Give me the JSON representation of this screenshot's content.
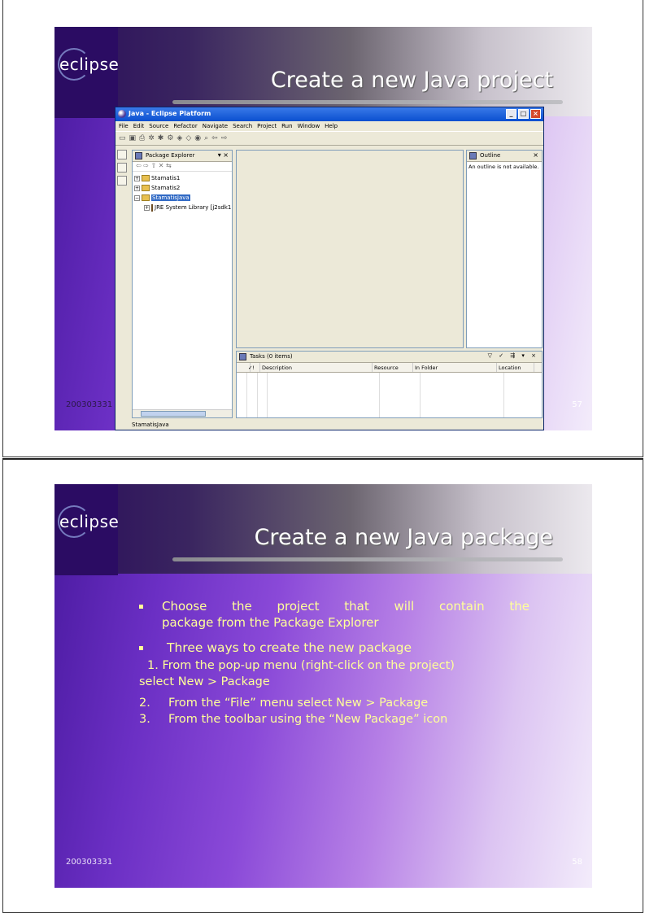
{
  "slide1": {
    "logo": "eclipse",
    "title": "Create a new Java project",
    "footer_id": "200303331",
    "page_number": "57",
    "window": {
      "title": "Java - Eclipse Platform",
      "menu": [
        "File",
        "Edit",
        "Source",
        "Refactor",
        "Navigate",
        "Search",
        "Project",
        "Run",
        "Window",
        "Help"
      ],
      "package_explorer": {
        "title": "Package Explorer",
        "items": [
          "Stamatis1",
          "Stamatis2",
          "StamatisJava"
        ],
        "child": "JRE System Library [j2sdk1"
      },
      "outline": {
        "title": "Outline",
        "message": "An outline is not available."
      },
      "tasks": {
        "title": "Tasks (0 items)",
        "columns": [
          "✓",
          "!",
          "Description",
          "Resource",
          "In Folder",
          "Location"
        ]
      },
      "status": "StamatisJava"
    }
  },
  "slide2": {
    "logo": "eclipse",
    "title": "Create a new Java package",
    "footer_id": "200303331",
    "page_number": "58",
    "bullet1_line1": "Choose the project that will contain the",
    "bullet1_line2": "package from the Package Explorer",
    "bullet2": "Three ways to create the new package",
    "step1_line1": "1.  From the pop-up menu (right-click on the project)",
    "step1_line2": "select New > Package",
    "step2_num": "2.",
    "step2_text": "From the “File” menu select New > Package",
    "step3_num": "3.",
    "step3_text": "From the toolbar using the “New Package” icon"
  }
}
